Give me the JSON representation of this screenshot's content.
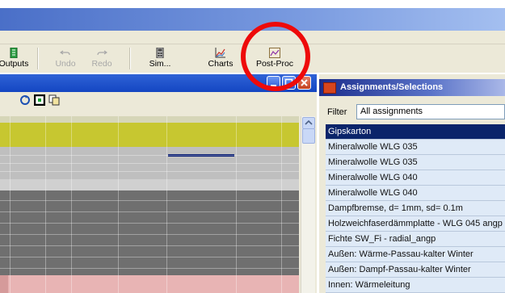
{
  "toolbar": {
    "buttons": [
      {
        "label": "Outputs",
        "icon": "outputs-icon",
        "enabled": true
      },
      {
        "label": "Undo",
        "icon": "undo-icon",
        "enabled": false
      },
      {
        "label": "Redo",
        "icon": "redo-icon",
        "enabled": false
      },
      {
        "label": "Sim...",
        "icon": "calculator-icon",
        "enabled": true
      },
      {
        "label": "Charts",
        "icon": "chart-icon",
        "enabled": true
      },
      {
        "label": "Post-Proc",
        "icon": "post-proc-icon",
        "enabled": true
      }
    ]
  },
  "assignments_panel": {
    "title": "Assignments/Selections",
    "filter_label": "Filter",
    "filter_value": "All assignments",
    "items": [
      "Gipskarton",
      "Mineralwolle WLG 035",
      "Mineralwolle WLG 035",
      "Mineralwolle WLG 040",
      "Mineralwolle WLG 040",
      "Dampfbremse, d= 1mm, sd= 0.1m",
      "Holzweichfaserdämmplatte - WLG 045 angp",
      "Fichte SW_Fi - radial_angp",
      "Außen: Wärme-Passau-kalter Winter",
      "Außen: Dampf-Passau-kalter Winter",
      "Innen: Wärmeleitung"
    ],
    "selected_index": 0
  },
  "colors": {
    "annotation_circle": "#ee0a0a",
    "selection": "#0a246a",
    "grid_yellow": "#c7c730",
    "grid_dark": "#6f6f6f",
    "grid_pink": "#e8b4b4"
  }
}
